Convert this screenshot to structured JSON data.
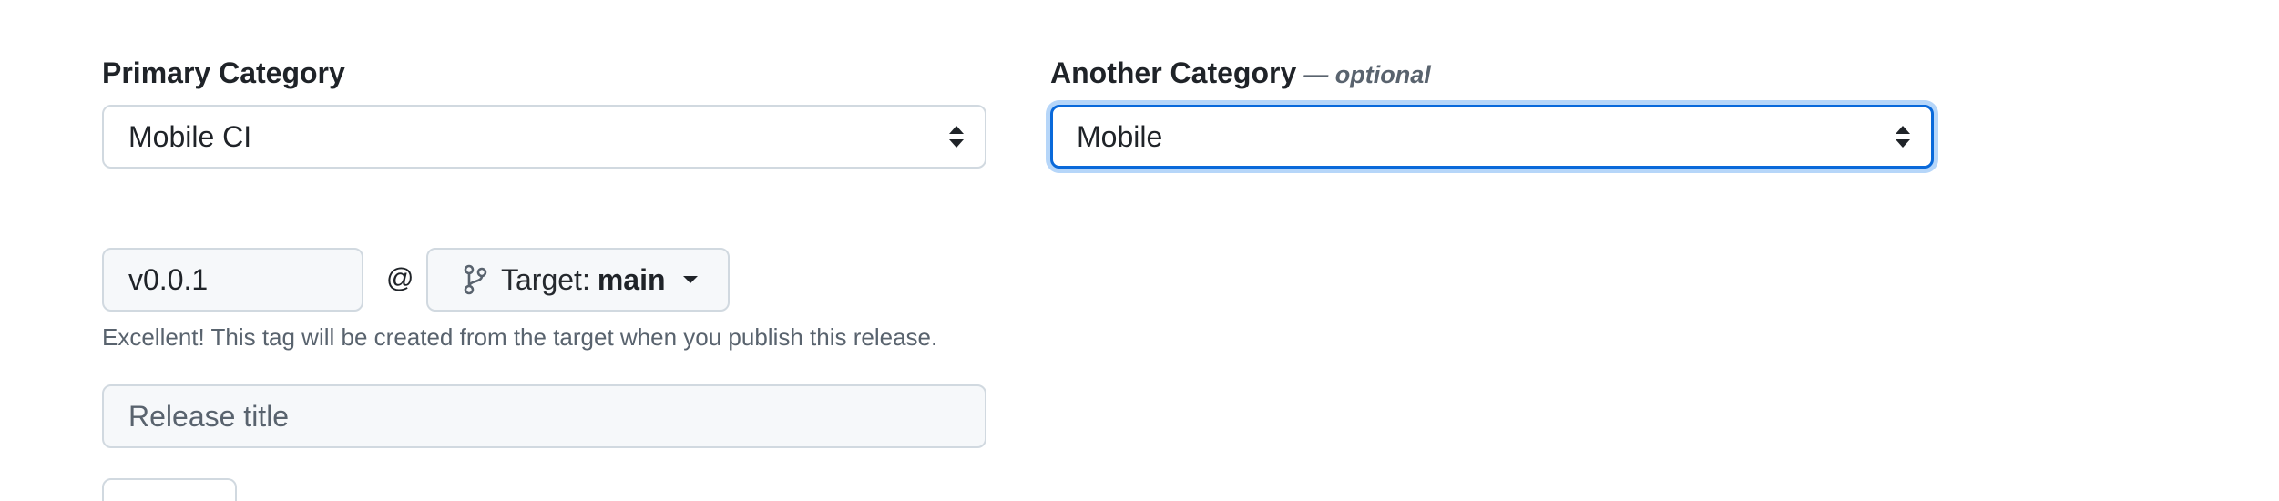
{
  "primary_category": {
    "label": "Primary Category",
    "selected": "Mobile CI"
  },
  "another_category": {
    "label": "Another Category",
    "optional": "— optional",
    "selected": "Mobile"
  },
  "tag": {
    "value": "v0.0.1",
    "at": "@",
    "target_prefix": "Target:",
    "target_branch": "main",
    "help": "Excellent! This tag will be created from the target when you publish this release."
  },
  "release_title": {
    "placeholder": "Release title"
  },
  "icons": {
    "select_arrows": "select-arrows-icon",
    "branch": "git-branch-icon",
    "caret": "caret-down-icon"
  },
  "colors": {
    "focus_border": "#0969da",
    "focus_ring": "#b6d6f9",
    "input_bg": "#f6f8fa",
    "border": "#d1d9e0",
    "muted_text": "#59636e"
  }
}
